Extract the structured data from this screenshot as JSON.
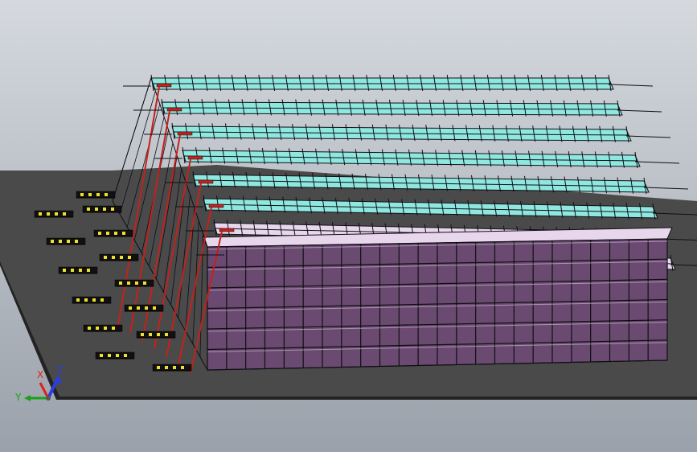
{
  "colors": {
    "background_top": "#d5d9de",
    "background_bottom": "#9aa1aa",
    "floor": "#4a4a4a",
    "floor_edge": "#232323",
    "frame": "#0f0f14",
    "rack_cyan": "#8fe8e0",
    "rack_purple": "#6a4a70",
    "rack_purple_light": "#c9b1d2",
    "shelf_top_purple": "#e8d7ec",
    "crane_red": "#c4211c",
    "conveyor_yellow": "#f1e02a",
    "axis_x": "#e0201b",
    "axis_y": "#1aa01a",
    "axis_z": "#2b3ce0"
  },
  "triad": {
    "x_label": "X",
    "y_label": "Y",
    "z_label": "Z",
    "icons": [
      "x-axis-arrow-icon",
      "y-axis-arrow-icon",
      "z-axis-arrow-icon"
    ]
  },
  "model": {
    "rack_rows": 8,
    "cyan_rows": 6,
    "purple_rows": 2,
    "front_bays": 24,
    "front_levels": 6,
    "conveyor_stations": 14
  }
}
